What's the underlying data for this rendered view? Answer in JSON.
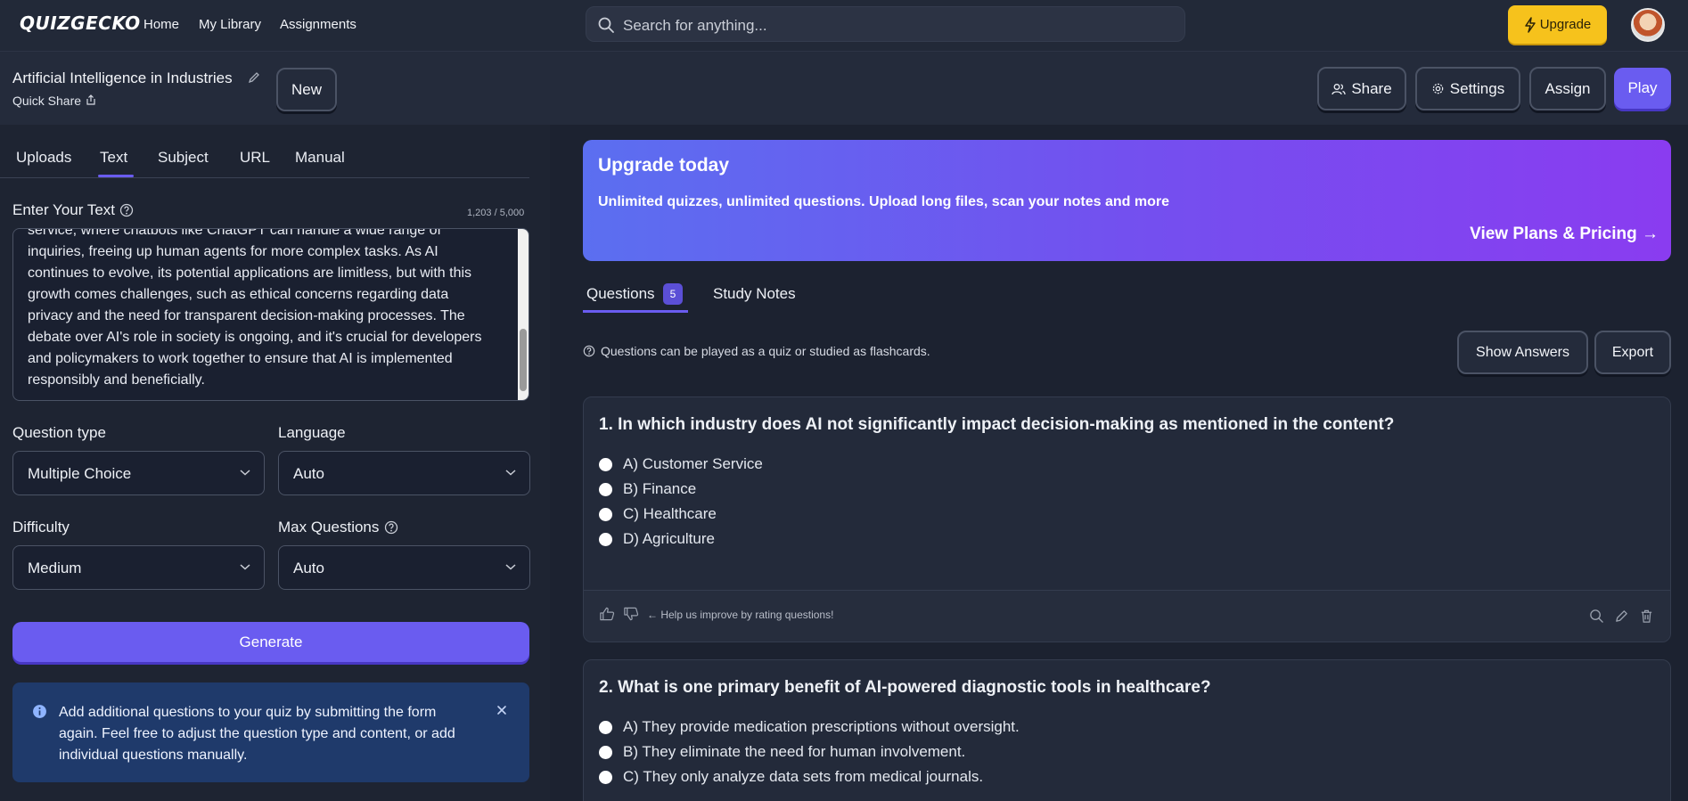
{
  "nav": {
    "logo": "QUIZGECKO",
    "links": [
      "Home",
      "My Library",
      "Assignments"
    ],
    "search_placeholder": "Search for anything...",
    "upgrade_label": "Upgrade",
    "upgrade_color": "#f6c21c"
  },
  "header": {
    "quiz_title": "Artificial Intelligence in Industries",
    "quick_share": "Quick Share",
    "new_label": "New",
    "share_label": "Share",
    "settings_label": "Settings",
    "assign_label": "Assign",
    "play_label": "Play",
    "accent_color": "#6a5cf0"
  },
  "left": {
    "tabs": [
      "Uploads",
      "Text",
      "Subject",
      "URL",
      "Manual"
    ],
    "active_tab": "Text",
    "enter_text_label": "Enter Your Text",
    "char_count": "1,203 / 5,000",
    "text_lines": [
      "service, where chatbots like ChatGPT can handle a wide range of",
      "inquiries, freeing up human agents for more complex tasks. As AI",
      "continues to evolve, its potential applications are limitless, but with this",
      "growth comes challenges, such as ethical concerns regarding data",
      "privacy and the need for transparent decision-making processes. The",
      "debate over AI's role in society is ongoing, and it's crucial for developers",
      "and policymakers to work together to ensure that AI is implemented",
      "responsibly and beneficially."
    ],
    "question_type_label": "Question type",
    "question_type_value": "Multiple Choice",
    "language_label": "Language",
    "language_value": "Auto",
    "difficulty_label": "Difficulty",
    "difficulty_value": "Medium",
    "max_questions_label": "Max Questions",
    "max_questions_value": "Auto",
    "generate_label": "Generate",
    "info_text": "Add additional questions to your quiz by submitting the form again. Feel free to adjust the question type and content, or add individual questions manually."
  },
  "right": {
    "promo_title": "Upgrade today",
    "promo_subtitle": "Unlimited quizzes, unlimited questions. Upload long files, scan your notes and more",
    "promo_cta": "View Plans & Pricing →",
    "tab_questions": "Questions",
    "questions_count": "5",
    "tab_study_notes": "Study Notes",
    "hint": "Questions can be played as a quiz or studied as flashcards.",
    "show_answers_label": "Show Answers",
    "export_label": "Export",
    "rate_hint": "← Help us improve by rating questions!",
    "questions": [
      {
        "text": "1. In which industry does AI not significantly impact decision-making as mentioned in the content?",
        "options": [
          "A) Customer Service",
          "B) Finance",
          "C) Healthcare",
          "D) Agriculture"
        ]
      },
      {
        "text": "2. What is one primary benefit of AI-powered diagnostic tools in healthcare?",
        "options": [
          "A) They provide medication prescriptions without oversight.",
          "B) They eliminate the need for human involvement.",
          "C) They only analyze data sets from medical journals."
        ]
      }
    ]
  }
}
